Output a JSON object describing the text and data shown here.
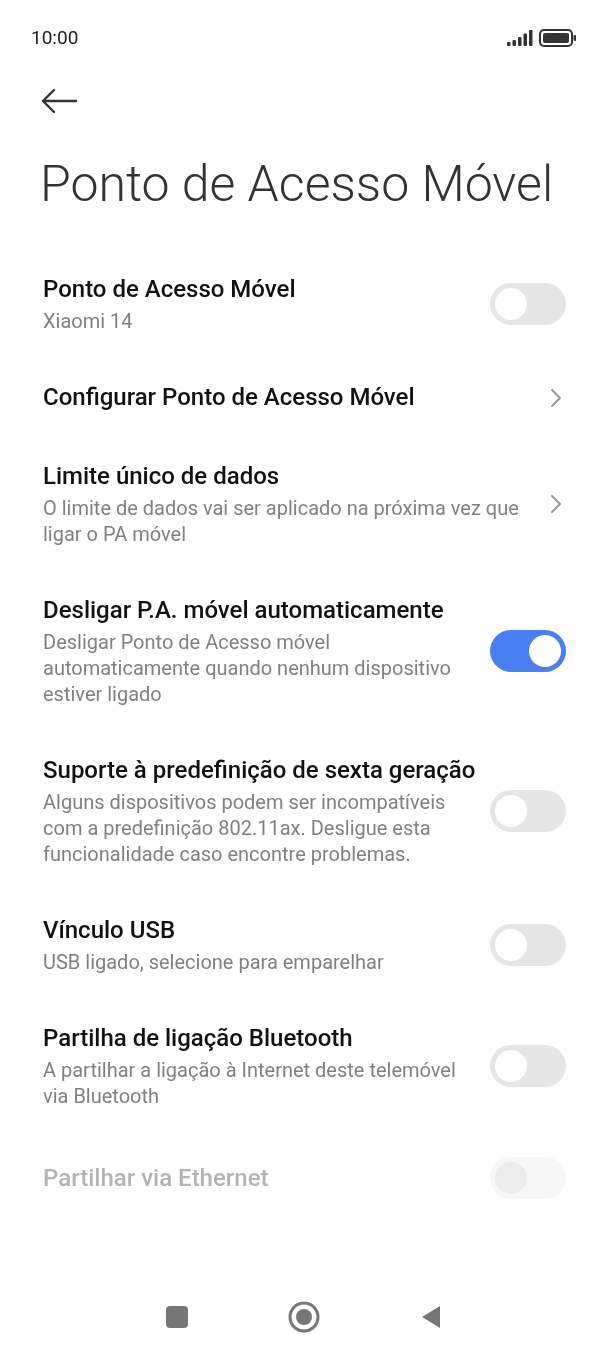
{
  "status_bar": {
    "time": "10:00"
  },
  "title": "Ponto de Acesso Móvel",
  "items": [
    {
      "kind": "toggle",
      "title": "Ponto de Acesso Móvel",
      "subtitle": "Xiaomi 14",
      "on": false,
      "disabled": false
    },
    {
      "kind": "link",
      "title": "Configurar Ponto de Acesso Móvel",
      "disabled": false
    },
    {
      "kind": "link",
      "title": "Limite único de dados",
      "subtitle": "O limite de dados vai ser aplicado na próxima vez que ligar o PA móvel",
      "disabled": false
    },
    {
      "kind": "toggle",
      "title": "Desligar P.A. móvel automaticamente",
      "subtitle": "Desligar Ponto de Acesso móvel automaticamente quando nenhum dispositivo estiver ligado",
      "on": true,
      "disabled": false
    },
    {
      "kind": "toggle",
      "title": "Suporte à predefinição de sexta geração",
      "subtitle": "Alguns dispositivos podem ser incompatíveis com a predefinição 802.11ax. Desligue esta funcionalidade caso encontre problemas.",
      "on": false,
      "disabled": false
    },
    {
      "kind": "toggle",
      "title": "Vínculo USB",
      "subtitle": "USB ligado, selecione para emparelhar",
      "on": false,
      "disabled": false
    },
    {
      "kind": "toggle",
      "title": "Partilha de ligação Bluetooth",
      "subtitle": "A partilhar a ligação à Internet deste telemóvel via Bluetooth",
      "on": false,
      "disabled": false
    },
    {
      "kind": "toggle",
      "title": "Partilhar via Ethernet",
      "on": false,
      "disabled": true
    }
  ]
}
